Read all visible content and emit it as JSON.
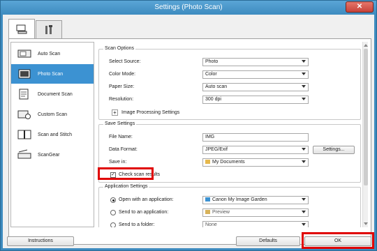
{
  "window": {
    "title": "Settings (Photo Scan)",
    "close": "✕"
  },
  "sidebar": {
    "items": [
      {
        "label": "Auto Scan"
      },
      {
        "label": "Photo Scan"
      },
      {
        "label": "Document Scan"
      },
      {
        "label": "Custom Scan"
      },
      {
        "label": "Scan and Stitch"
      },
      {
        "label": "ScanGear"
      }
    ]
  },
  "scan_options": {
    "title": "Scan Options",
    "select_source": {
      "label": "Select Source:",
      "value": "Photo"
    },
    "color_mode": {
      "label": "Color Mode:",
      "value": "Color"
    },
    "paper_size": {
      "label": "Paper Size:",
      "value": "Auto scan"
    },
    "resolution": {
      "label": "Resolution:",
      "value": "300 dpi"
    },
    "image_processing": {
      "label": "Image Processing Settings",
      "expander": "+"
    }
  },
  "save_settings": {
    "title": "Save Settings",
    "file_name": {
      "label": "File Name:",
      "value": "IMG"
    },
    "data_format": {
      "label": "Data Format:",
      "value": "JPEG/Exif",
      "button": "Settings..."
    },
    "save_in": {
      "label": "Save in:",
      "value": "My Documents"
    },
    "check_results": {
      "label": "Check scan results",
      "checked": "✓"
    }
  },
  "app_settings": {
    "title": "Application Settings",
    "open_with": {
      "label": "Open with an application:",
      "value": "Canon My Image Garden"
    },
    "send_to_app": {
      "label": "Send to an application:",
      "value": "Preview"
    },
    "send_to_folder": {
      "label": "Send to a folder:",
      "value": "None"
    }
  },
  "footer": {
    "instructions": "Instructions",
    "defaults": "Defaults",
    "ok": "OK"
  },
  "colors": {
    "accent": "#3c92d2",
    "highlight": "#e00000"
  }
}
